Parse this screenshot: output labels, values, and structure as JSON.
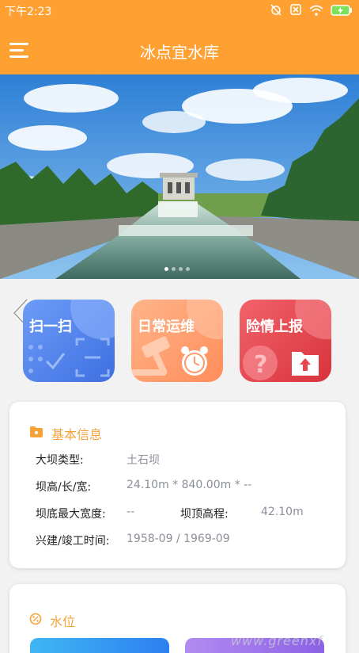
{
  "status_bar": {
    "time": "下午2:23"
  },
  "header": {
    "title": "冰点宜水库"
  },
  "banner": {
    "slide_count": 4,
    "active_slide": 1
  },
  "actions": [
    {
      "label": "扫一扫",
      "color": "#4a7ff0"
    },
    {
      "label": "日常运维",
      "color": "#ff9a6a"
    },
    {
      "label": "险情上报",
      "color": "#e8464c"
    }
  ],
  "basic_info": {
    "title": "基本信息",
    "dam_type_label": "大坝类型:",
    "dam_type_value": "土石坝",
    "dims_label": "坝高/长/宽:",
    "dims_value": "24.10m * 840.00m * --",
    "base_width_label": "坝底最大宽度:",
    "base_width_value": "--",
    "crest_elev_label": "坝顶高程:",
    "crest_elev_value": "42.10m",
    "build_label": "兴建/竣工时间:",
    "build_value": "1958-09 / 1969-09"
  },
  "water_level": {
    "title": "水位"
  },
  "watermark": "www.greenxf"
}
